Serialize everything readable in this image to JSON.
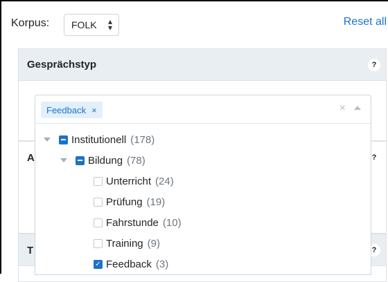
{
  "topbar": {
    "korpus_label": "Korpus:",
    "korpus_value": "FOLK",
    "reset_label": "Reset all"
  },
  "panels": {
    "gespraechstyp_title": "Gesprächstyp",
    "help_glyph": "?",
    "second_panel_initial": "A",
    "third_panel_initial": "T"
  },
  "multiselect": {
    "chips": [
      {
        "label": "Feedback",
        "remove_glyph": "×"
      }
    ],
    "clear_glyph": "×",
    "tree": [
      {
        "label": "Institutionell",
        "count": "(178)",
        "state": "partial"
      },
      {
        "label": "Bildung",
        "count": "(78)",
        "state": "partial"
      },
      {
        "label": "Unterricht",
        "count": "(24)",
        "state": "unchecked"
      },
      {
        "label": "Prüfung",
        "count": "(19)",
        "state": "unchecked"
      },
      {
        "label": "Fahrstunde",
        "count": "(10)",
        "state": "unchecked"
      },
      {
        "label": "Training",
        "count": "(9)",
        "state": "unchecked"
      },
      {
        "label": "Feedback",
        "count": "(3)",
        "state": "checked"
      }
    ]
  },
  "colors": {
    "accent": "#1a73c9",
    "header_bg": "#e9eef3",
    "chip_bg": "#e3f0fb"
  }
}
